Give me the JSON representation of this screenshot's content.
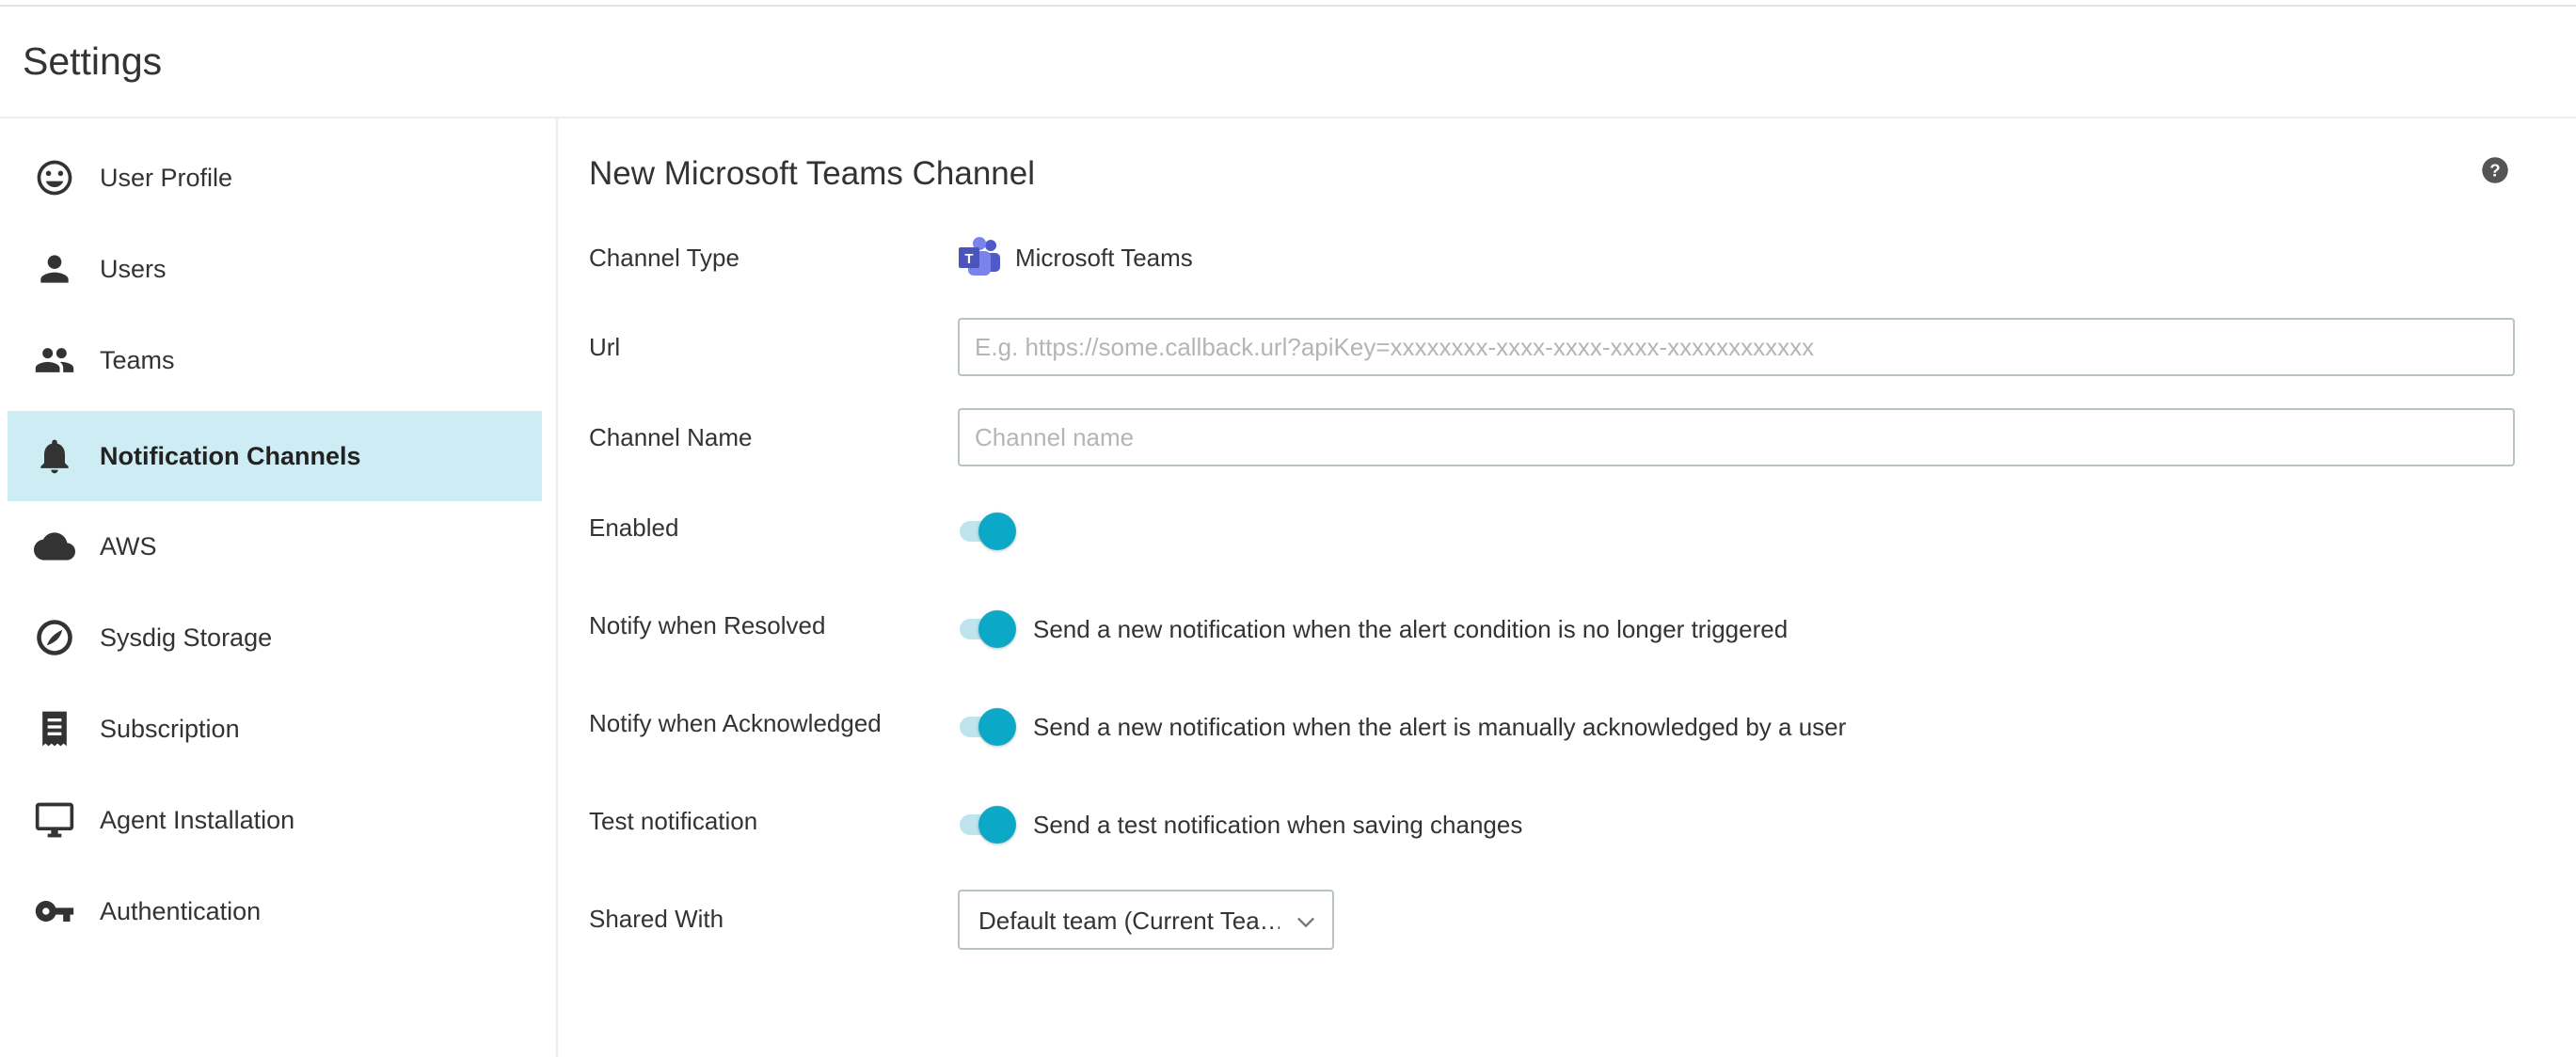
{
  "app": {
    "title": "Settings"
  },
  "sidebar": {
    "items": [
      {
        "label": "User Profile",
        "icon": "smiley-icon",
        "active": false
      },
      {
        "label": "Users",
        "icon": "person-icon",
        "active": false
      },
      {
        "label": "Teams",
        "icon": "group-icon",
        "active": false
      },
      {
        "label": "Notification Channels",
        "icon": "bell-icon",
        "active": true
      },
      {
        "label": "AWS",
        "icon": "cloud-icon",
        "active": false
      },
      {
        "label": "Sysdig Storage",
        "icon": "storage-icon",
        "active": false
      },
      {
        "label": "Subscription",
        "icon": "receipt-icon",
        "active": false
      },
      {
        "label": "Agent Installation",
        "icon": "monitor-icon",
        "active": false
      },
      {
        "label": "Authentication",
        "icon": "key-icon",
        "active": false
      }
    ]
  },
  "main": {
    "title": "New Microsoft Teams Channel",
    "help_icon": "help-icon",
    "form": {
      "channel_type": {
        "label": "Channel Type",
        "value": "Microsoft Teams",
        "icon": "microsoft-teams-icon"
      },
      "url": {
        "label": "Url",
        "value": "",
        "placeholder": "E.g. https://some.callback.url?apiKey=xxxxxxxx-xxxx-xxxx-xxxx-xxxxxxxxxxxx"
      },
      "channel_name": {
        "label": "Channel Name",
        "value": "",
        "placeholder": "Channel name"
      },
      "enabled": {
        "label": "Enabled",
        "on": true
      },
      "notify_resolved": {
        "label": "Notify when Resolved",
        "on": true,
        "description": "Send a new notification when the alert condition is no longer triggered"
      },
      "notify_acknowledged": {
        "label": "Notify when Acknowledged",
        "on": true,
        "description": "Send a new notification when the alert is manually acknowledged by a user"
      },
      "test_notification": {
        "label": "Test notification",
        "on": true,
        "description": "Send a test notification when saving changes"
      },
      "shared_with": {
        "label": "Shared With",
        "value": "Default team (Current Tea…"
      }
    }
  },
  "colors": {
    "accent": "#0ba8c8",
    "toggle_track": "#bfe4ee",
    "active_nav_bg": "#cdecf3",
    "teams_purple": "#5059c9"
  }
}
